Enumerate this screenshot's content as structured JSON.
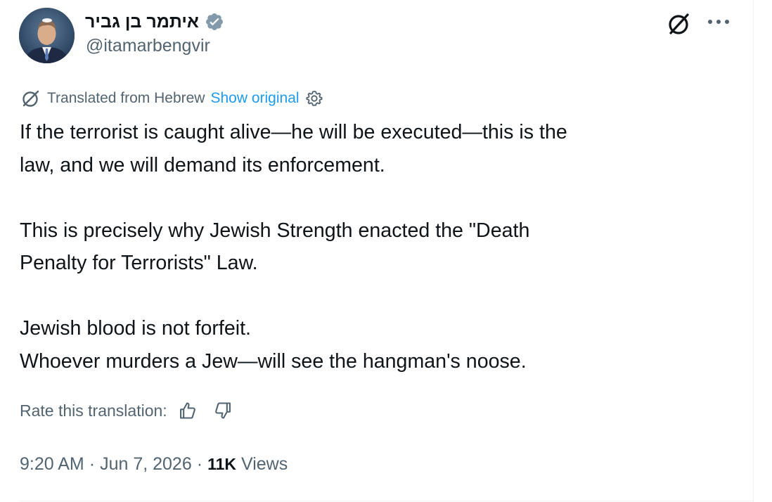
{
  "author": {
    "name": "איתמר בן גביר",
    "handle": "@itamarbengvir",
    "verified": true
  },
  "header_icons": {
    "grok": "grok-icon",
    "more": "more-icon"
  },
  "translation": {
    "label": "Translated from Hebrew",
    "show_original": "Show original",
    "settings_icon": "gear-icon"
  },
  "tweet": {
    "paragraphs": [
      [
        "If the terrorist is caught alive—he will be executed—this is the",
        "law, and we will demand its enforcement."
      ],
      [
        "This is precisely why Jewish Strength enacted the \"Death",
        "Penalty for Terrorists\" Law."
      ],
      [
        "Jewish blood is not forfeit.",
        "Whoever murders a Jew—will see the hangman's noose."
      ]
    ]
  },
  "rating": {
    "label": "Rate this translation:"
  },
  "meta": {
    "time": "9:20 AM",
    "date": "Jun 7, 2026",
    "views_count": "11K",
    "views_label": "Views",
    "separator": "·"
  },
  "colors": {
    "text": "#0f1419",
    "secondary": "#536471",
    "link": "#1d9bf0",
    "verified": "#829aab",
    "divider": "#eff3f4"
  }
}
